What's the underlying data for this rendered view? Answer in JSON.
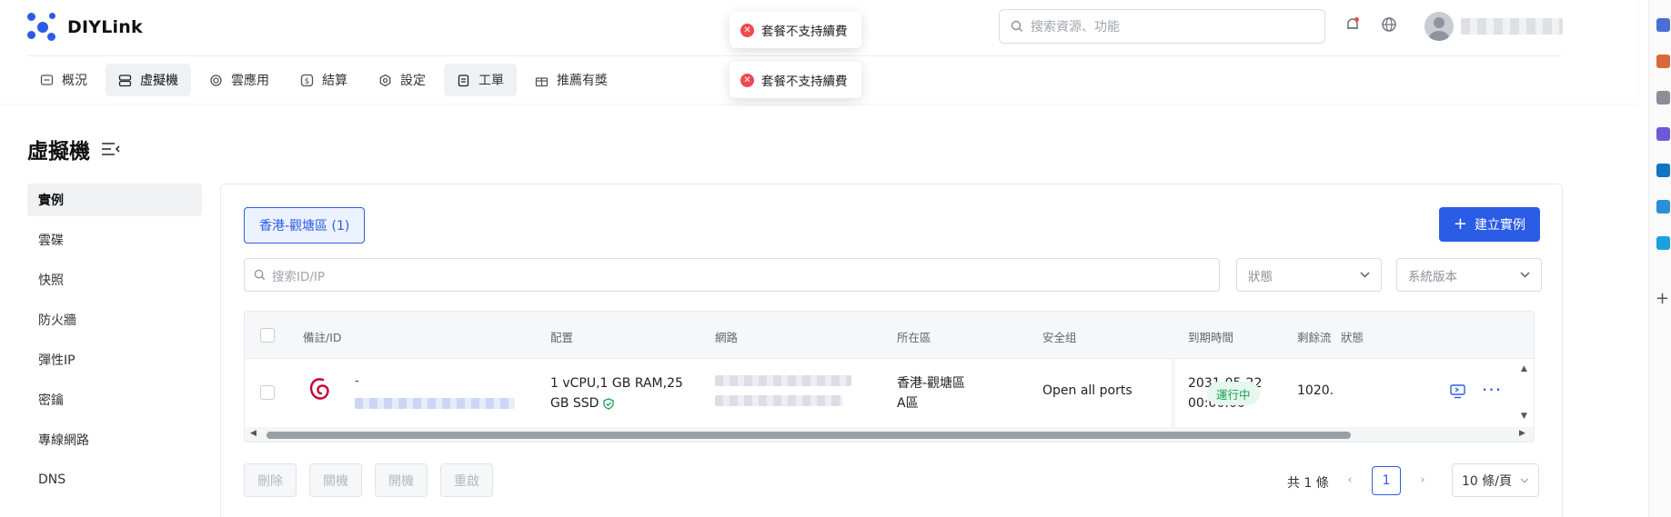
{
  "app": {
    "name": "DIYLink"
  },
  "header": {
    "search_placeholder": "搜索資源、功能",
    "icons": [
      "bell-icon",
      "globe-icon"
    ],
    "brand_color": "#2b5ce6"
  },
  "nav": [
    {
      "label": "概況",
      "icon": "dashboard-icon"
    },
    {
      "label": "虛擬機",
      "icon": "server-icon",
      "active": true
    },
    {
      "label": "雲應用",
      "icon": "cloud-app-icon"
    },
    {
      "label": "結算",
      "icon": "dollar-icon"
    },
    {
      "label": "設定",
      "icon": "gear-icon"
    },
    {
      "label": "工單",
      "icon": "ticket-icon"
    },
    {
      "label": "推薦有獎",
      "icon": "gift-icon"
    }
  ],
  "toasts": [
    {
      "message": "套餐不支持續費",
      "type": "error"
    },
    {
      "message": "套餐不支持續費",
      "type": "error"
    }
  ],
  "page": {
    "title": "虛擬機"
  },
  "side_menu": [
    {
      "label": "實例",
      "active": true
    },
    {
      "label": "雲碟"
    },
    {
      "label": "快照"
    },
    {
      "label": "防火牆"
    },
    {
      "label": "彈性IP"
    },
    {
      "label": "密鑰"
    },
    {
      "label": "專線網路"
    },
    {
      "label": "DNS"
    }
  ],
  "main": {
    "region_tab": "香港-觀塘區 (1)",
    "create_button": "建立實例",
    "search_placeholder": "搜索ID/IP",
    "status_select": "狀態",
    "os_select": "系統版本",
    "table": {
      "headers": [
        "備註/ID",
        "配置",
        "網路",
        "所在區",
        "安全组",
        "到期時間",
        "剩餘流",
        "狀態"
      ],
      "rows": [
        {
          "remark": "-",
          "config_line1": "1 vCPU,1 GB RAM,25",
          "config_line2": "GB SSD",
          "zone_line1": "香港-觀塘區",
          "zone_line2": "A區",
          "security_group": "Open all ports",
          "expire_line1": "2031-05-22",
          "expire_line2": "00:00:00",
          "traffic": "1020.",
          "status": "運行中",
          "status_color": "#1a9e56"
        }
      ]
    },
    "actions": [
      "刪除",
      "關機",
      "開機",
      "重啟"
    ],
    "pagination": {
      "total": "共 1 條",
      "current": "1",
      "page_size": "10 條/頁"
    }
  }
}
